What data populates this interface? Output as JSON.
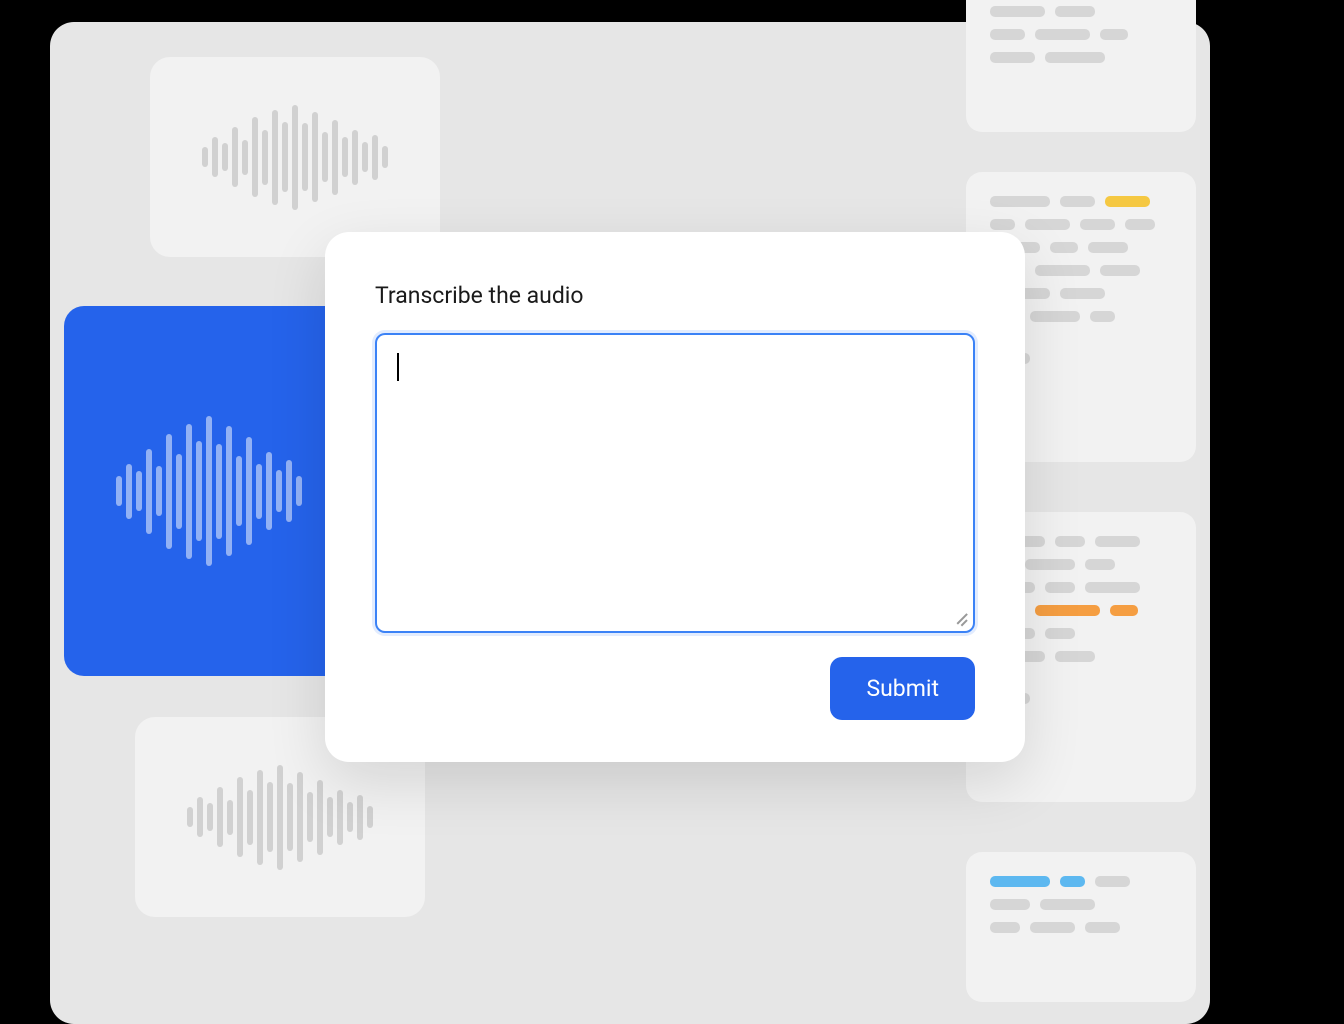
{
  "modal": {
    "title": "Transcribe the audio",
    "submit_label": "Submit"
  },
  "colors": {
    "primary": "#2563eb",
    "accent_yellow": "#f5c842",
    "accent_orange": "#f59e42",
    "accent_blue": "#5db8f0"
  }
}
